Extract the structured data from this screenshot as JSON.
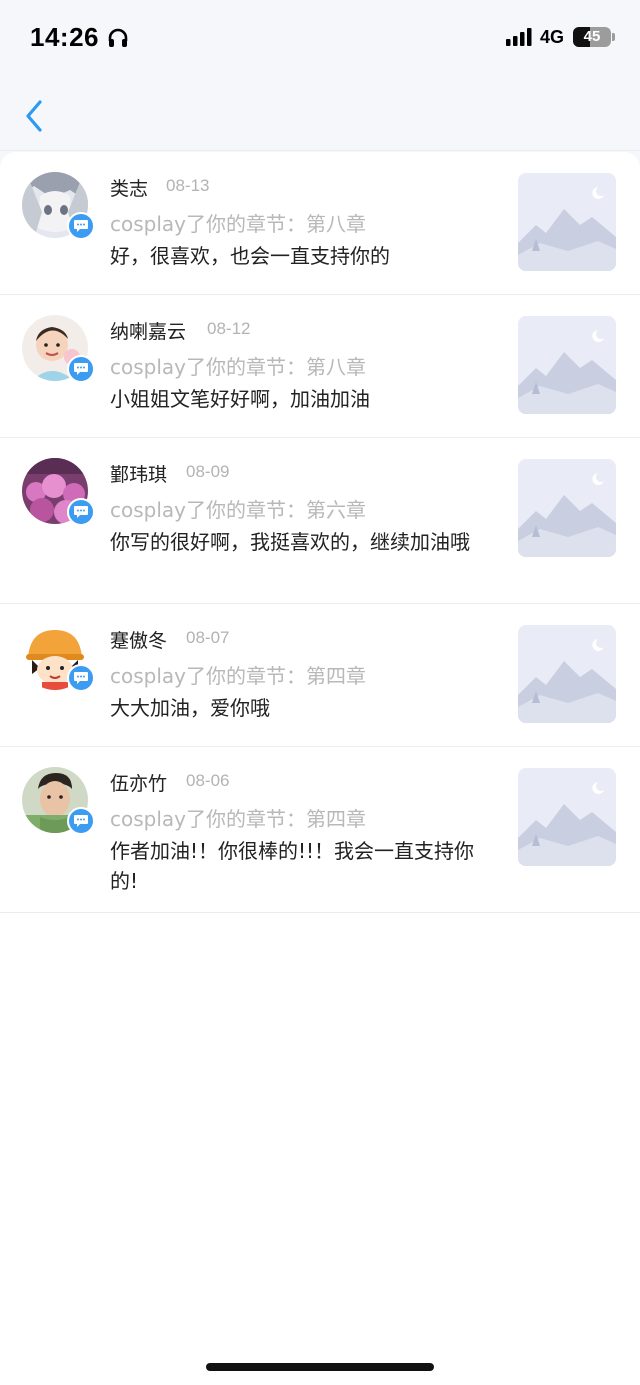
{
  "status_bar": {
    "time": "14:26",
    "network": "4G",
    "battery": "45",
    "battery_level_percent": 45
  },
  "nav": {
    "back_icon": "chevron-left-icon",
    "accent_color": "#2b9af3"
  },
  "notices": [
    {
      "name": "类志",
      "date": "08-13",
      "action": "cosplay了你的章节：第八章",
      "message": "好，很喜欢，也会一直支持你的",
      "avatar": "anime-girl-avatar"
    },
    {
      "name": "纳喇嘉云",
      "date": "08-12",
      "action": "cosplay了你的章节：第八章",
      "message": "小姐姐文笔好好啊，加油加油",
      "avatar": "child-photo-avatar"
    },
    {
      "name": "鄞玮琪",
      "date": "08-09",
      "action": "cosplay了你的章节：第六章",
      "message": "你写的很好啊，我挺喜欢的，继续加油哦",
      "avatar": "pink-flowers-avatar"
    },
    {
      "name": "蹇傲冬",
      "date": "08-07",
      "action": "cosplay了你的章节：第四章",
      "message": "大大加油，爱你哦",
      "avatar": "cartoon-girl-avatar"
    },
    {
      "name": "伍亦竹",
      "date": "08-06",
      "action": "cosplay了你的章节：第四章",
      "message": "作者加油!！你很棒的!!！我会一直支持你的!",
      "avatar": "man-portrait-avatar"
    }
  ]
}
